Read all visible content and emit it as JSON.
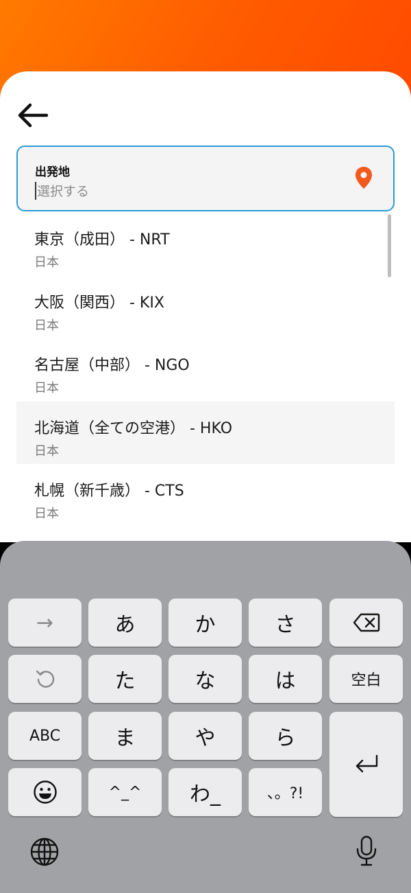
{
  "header": {
    "accent": "#ff6a00"
  },
  "search": {
    "label": "出発地",
    "placeholder": "選択する",
    "border_color": "#2a9ad6",
    "pin_color": "#f25a1d"
  },
  "airports": [
    {
      "name": "東京（成田） - NRT",
      "country": "日本"
    },
    {
      "name": "大阪（関西） - KIX",
      "country": "日本"
    },
    {
      "name": "名古屋（中部） - NGO",
      "country": "日本"
    },
    {
      "name": "北海道（全ての空港） - HKO",
      "country": "日本"
    },
    {
      "name": "札幌（新千歳） - CTS",
      "country": "日本"
    }
  ],
  "keyboard": {
    "row1": [
      "→",
      "あ",
      "か",
      "さ"
    ],
    "row2": [
      "た",
      "な",
      "は",
      "空白"
    ],
    "row3": [
      "ABC",
      "ま",
      "や",
      "ら"
    ],
    "row4": [
      "^_^",
      "わ_",
      "、。?!"
    ],
    "icons": [
      "backspace-icon",
      "undo-icon",
      "return-icon",
      "emoji-icon",
      "globe-icon",
      "microphone-icon"
    ]
  }
}
